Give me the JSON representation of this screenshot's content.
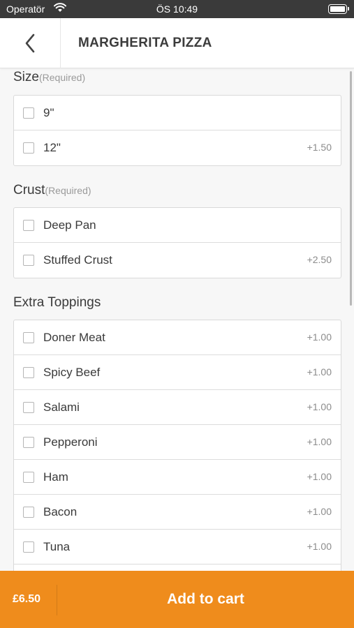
{
  "status_bar": {
    "carrier": "Operatör",
    "time": "ÖS 10:49",
    "battery_level": 1.0
  },
  "header": {
    "title": "MARGHERITA PIZZA",
    "back_icon": "chevron-left-icon"
  },
  "sections": [
    {
      "title": "Size",
      "required_label": "(Required)",
      "options": [
        {
          "label": "9\"",
          "price": "",
          "checked": false
        },
        {
          "label": "12\"",
          "price": "+1.50",
          "checked": false
        }
      ]
    },
    {
      "title": "Crust",
      "required_label": "(Required)",
      "options": [
        {
          "label": "Deep Pan",
          "price": "",
          "checked": false
        },
        {
          "label": "Stuffed Crust",
          "price": "+2.50",
          "checked": false
        }
      ]
    },
    {
      "title": "Extra Toppings",
      "required_label": "",
      "options": [
        {
          "label": "Doner Meat",
          "price": "+1.00",
          "checked": false
        },
        {
          "label": "Spicy Beef",
          "price": "+1.00",
          "checked": false
        },
        {
          "label": "Salami",
          "price": "+1.00",
          "checked": false
        },
        {
          "label": "Pepperoni",
          "price": "+1.00",
          "checked": false
        },
        {
          "label": "Ham",
          "price": "+1.00",
          "checked": false
        },
        {
          "label": "Bacon",
          "price": "+1.00",
          "checked": false
        },
        {
          "label": "Tuna",
          "price": "+1.00",
          "checked": false
        },
        {
          "label": "",
          "price": "",
          "checked": false
        }
      ]
    }
  ],
  "footer": {
    "total": "£6.50",
    "add_to_cart_label": "Add to cart"
  },
  "colors": {
    "accent": "#ef8c1c",
    "status_bar": "#3a3a3a",
    "background": "#f7f7f7"
  }
}
